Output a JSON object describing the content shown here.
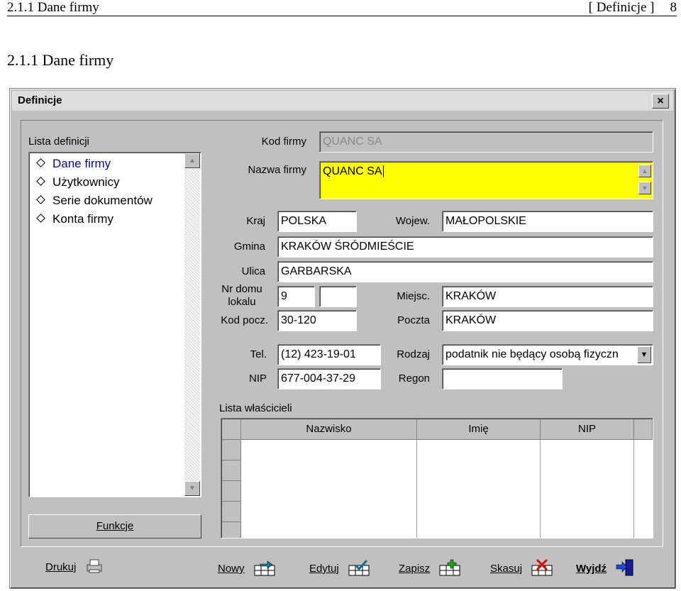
{
  "doc_header": {
    "left": "2.1.1 Dane firmy",
    "right": "[ Definicje ]",
    "page": "8"
  },
  "doc_heading": "2.1.1 Dane firmy",
  "window": {
    "title": "Definicje",
    "close_label": "×"
  },
  "sidebar": {
    "title": "Lista definicji",
    "items": [
      {
        "label": "Dane firmy"
      },
      {
        "label": "Użytkownicy"
      },
      {
        "label": "Serie dokumentów"
      },
      {
        "label": "Konta firmy"
      }
    ],
    "button_label": "Funkcje"
  },
  "form": {
    "kod_firmy": {
      "label": "Kod firmy",
      "value": "QUANC SA"
    },
    "nazwa_firmy": {
      "label": "Nazwa firmy",
      "value": "QUANC SA"
    },
    "kraj": {
      "label": "Kraj",
      "value": "POLSKA"
    },
    "wojew": {
      "label": "Wojew.",
      "value": "MAŁOPOLSKIE"
    },
    "gmina": {
      "label": "Gmina",
      "value": "KRAKÓW ŚRÓDMIEŚCIE"
    },
    "ulica": {
      "label": "Ulica",
      "value": "GARBARSKA"
    },
    "nr_domu": {
      "label_line1": "Nr domu",
      "label_line2": "lokalu",
      "value": "9",
      "value2": ""
    },
    "miejsc": {
      "label": "Miejsc.",
      "value": "KRAKÓW"
    },
    "kod_pocz": {
      "label": "Kod pocz.",
      "value": "30-120"
    },
    "poczta": {
      "label": "Poczta",
      "value": "KRAKÓW"
    },
    "tel": {
      "label": "Tel.",
      "value": "(12) 423-19-01"
    },
    "rodzaj": {
      "label": "Rodzaj",
      "value": "podatnik nie będący osobą fizyczn"
    },
    "nip": {
      "label": "NIP",
      "value": "677-004-37-29"
    },
    "regon": {
      "label": "Regon",
      "value": ""
    }
  },
  "owners": {
    "title": "Lista właścicieli",
    "columns": [
      "Nazwisko",
      "Imię",
      "NIP"
    ]
  },
  "toolbar": {
    "drukuj": "Drukuj",
    "nowy": "Nowy",
    "edytuj": "Edytuj",
    "zapisz": "Zapisz",
    "skasuj": "Skasuj",
    "wyjdz": "Wyjdź"
  },
  "colors": {
    "highlight_field": "#ffff00",
    "window_bg": "#c0c0c0",
    "selected_item": "#0a0a80"
  }
}
